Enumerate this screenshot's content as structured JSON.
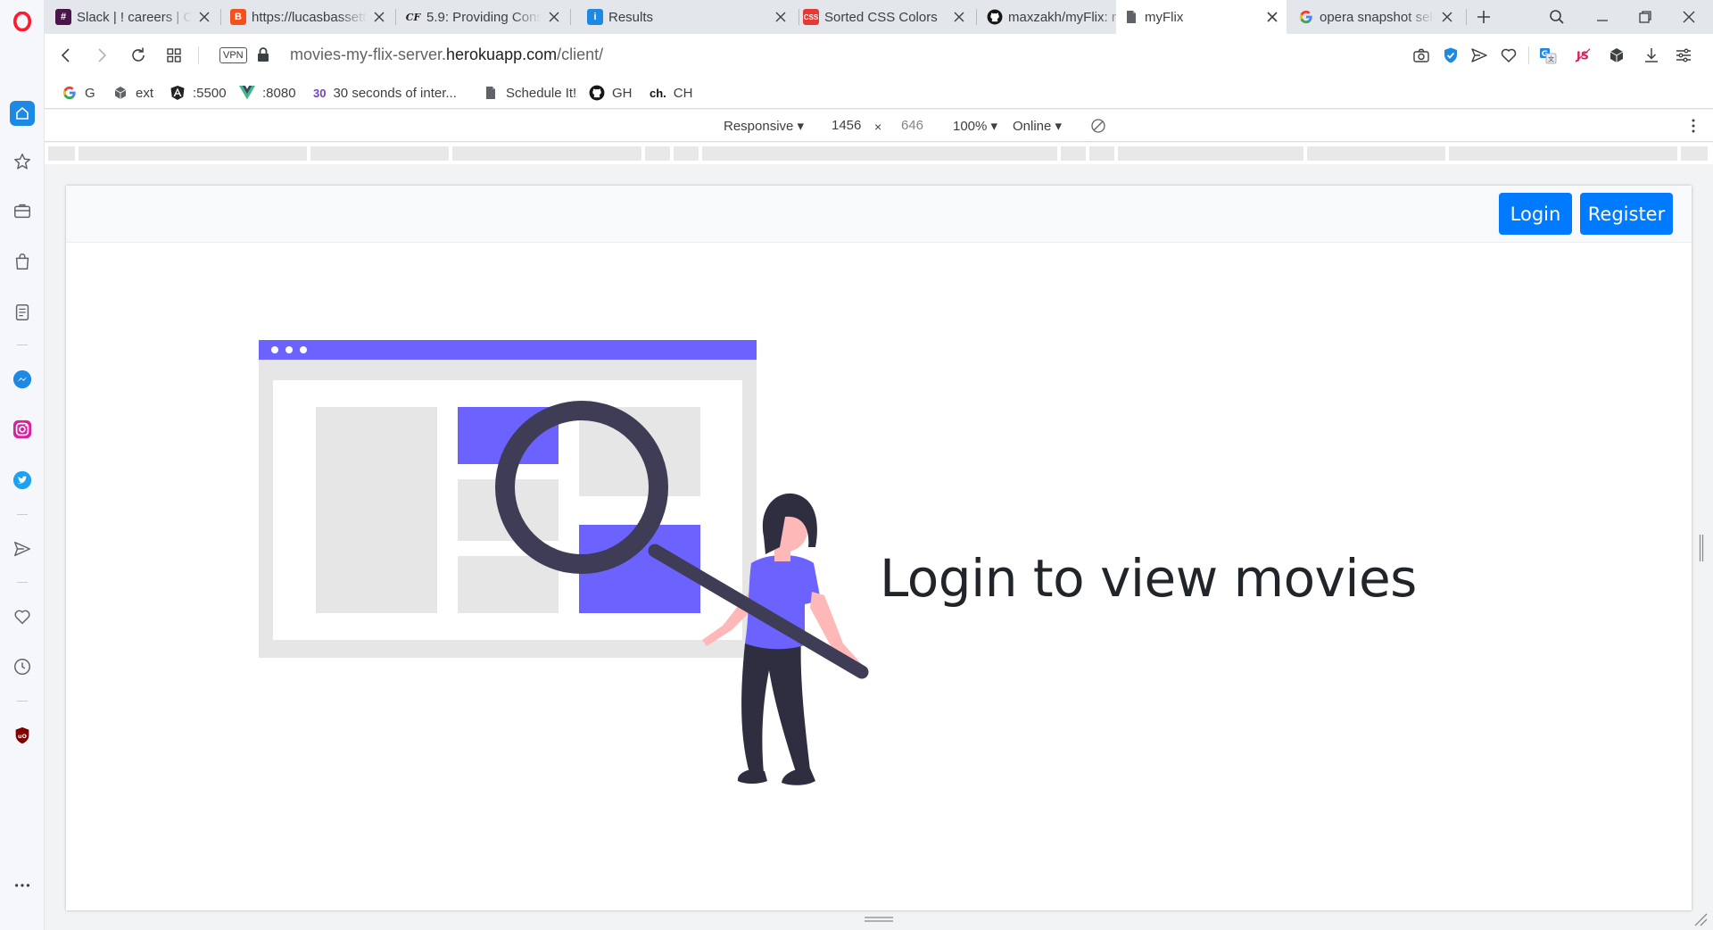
{
  "browser": {
    "tabs": [
      {
        "title": "Slack | ! careers | Ca",
        "icon": "slack-icon",
        "active": false
      },
      {
        "title": "https://lucasbassett",
        "icon": "blogger-icon",
        "active": false
      },
      {
        "title": "5.9: Providing Const",
        "icon": "careerfoundry-icon",
        "active": false
      },
      {
        "title": "Results",
        "icon": "results-icon",
        "active": false
      },
      {
        "title": "Sorted CSS Colors",
        "icon": "css-icon",
        "active": false
      },
      {
        "title": "maxzakh/myFlix: my",
        "icon": "github-icon",
        "active": false
      },
      {
        "title": "myFlix",
        "icon": "document-icon",
        "active": true
      },
      {
        "title": "opera snapshot sele",
        "icon": "google-icon",
        "active": false
      }
    ],
    "url": {
      "prefix": "movies-my-flix-server.",
      "host": "herokuapp.com",
      "path": "/client/"
    },
    "vpn_label": "VPN",
    "bookmarks": [
      {
        "label": "G",
        "icon": "google-icon"
      },
      {
        "label": "ext",
        "icon": "extensions-icon"
      },
      {
        "label": ":5500",
        "icon": "angular-icon"
      },
      {
        "label": ":8080",
        "icon": "vue-icon"
      },
      {
        "label": "30 seconds of inter...",
        "icon_text": "30"
      },
      {
        "label": "Schedule It!",
        "icon": "document-icon"
      },
      {
        "label": "GH",
        "icon": "github-icon"
      },
      {
        "label": "CH",
        "icon_text": "ch."
      }
    ],
    "device_toolbar": {
      "mode": "Responsive",
      "width": "1456",
      "times": "×",
      "height": "646",
      "zoom": "100%",
      "network": "Online"
    }
  },
  "app": {
    "nav": {
      "login_label": "Login",
      "register_label": "Register",
      "button_color": "#007bff"
    },
    "hero_text": "Login to view movies",
    "illustration_accent": "#6c63ff"
  }
}
